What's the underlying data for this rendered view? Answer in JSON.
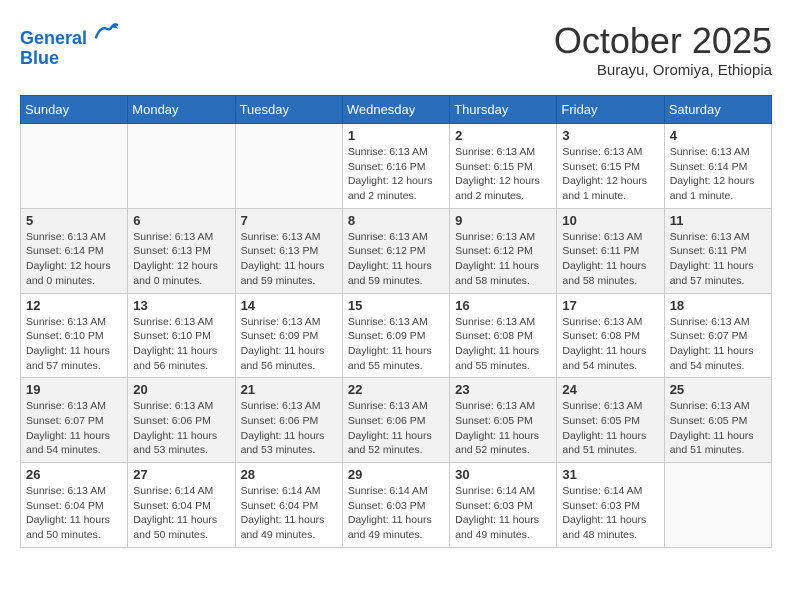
{
  "logo": {
    "line1": "General",
    "line2": "Blue"
  },
  "title": "October 2025",
  "subtitle": "Burayu, Oromiya, Ethiopia",
  "headers": [
    "Sunday",
    "Monday",
    "Tuesday",
    "Wednesday",
    "Thursday",
    "Friday",
    "Saturday"
  ],
  "weeks": [
    [
      {
        "day": "",
        "info": ""
      },
      {
        "day": "",
        "info": ""
      },
      {
        "day": "",
        "info": ""
      },
      {
        "day": "1",
        "info": "Sunrise: 6:13 AM\nSunset: 6:16 PM\nDaylight: 12 hours\nand 2 minutes."
      },
      {
        "day": "2",
        "info": "Sunrise: 6:13 AM\nSunset: 6:15 PM\nDaylight: 12 hours\nand 2 minutes."
      },
      {
        "day": "3",
        "info": "Sunrise: 6:13 AM\nSunset: 6:15 PM\nDaylight: 12 hours\nand 1 minute."
      },
      {
        "day": "4",
        "info": "Sunrise: 6:13 AM\nSunset: 6:14 PM\nDaylight: 12 hours\nand 1 minute."
      }
    ],
    [
      {
        "day": "5",
        "info": "Sunrise: 6:13 AM\nSunset: 6:14 PM\nDaylight: 12 hours\nand 0 minutes."
      },
      {
        "day": "6",
        "info": "Sunrise: 6:13 AM\nSunset: 6:13 PM\nDaylight: 12 hours\nand 0 minutes."
      },
      {
        "day": "7",
        "info": "Sunrise: 6:13 AM\nSunset: 6:13 PM\nDaylight: 11 hours\nand 59 minutes."
      },
      {
        "day": "8",
        "info": "Sunrise: 6:13 AM\nSunset: 6:12 PM\nDaylight: 11 hours\nand 59 minutes."
      },
      {
        "day": "9",
        "info": "Sunrise: 6:13 AM\nSunset: 6:12 PM\nDaylight: 11 hours\nand 58 minutes."
      },
      {
        "day": "10",
        "info": "Sunrise: 6:13 AM\nSunset: 6:11 PM\nDaylight: 11 hours\nand 58 minutes."
      },
      {
        "day": "11",
        "info": "Sunrise: 6:13 AM\nSunset: 6:11 PM\nDaylight: 11 hours\nand 57 minutes."
      }
    ],
    [
      {
        "day": "12",
        "info": "Sunrise: 6:13 AM\nSunset: 6:10 PM\nDaylight: 11 hours\nand 57 minutes."
      },
      {
        "day": "13",
        "info": "Sunrise: 6:13 AM\nSunset: 6:10 PM\nDaylight: 11 hours\nand 56 minutes."
      },
      {
        "day": "14",
        "info": "Sunrise: 6:13 AM\nSunset: 6:09 PM\nDaylight: 11 hours\nand 56 minutes."
      },
      {
        "day": "15",
        "info": "Sunrise: 6:13 AM\nSunset: 6:09 PM\nDaylight: 11 hours\nand 55 minutes."
      },
      {
        "day": "16",
        "info": "Sunrise: 6:13 AM\nSunset: 6:08 PM\nDaylight: 11 hours\nand 55 minutes."
      },
      {
        "day": "17",
        "info": "Sunrise: 6:13 AM\nSunset: 6:08 PM\nDaylight: 11 hours\nand 54 minutes."
      },
      {
        "day": "18",
        "info": "Sunrise: 6:13 AM\nSunset: 6:07 PM\nDaylight: 11 hours\nand 54 minutes."
      }
    ],
    [
      {
        "day": "19",
        "info": "Sunrise: 6:13 AM\nSunset: 6:07 PM\nDaylight: 11 hours\nand 54 minutes."
      },
      {
        "day": "20",
        "info": "Sunrise: 6:13 AM\nSunset: 6:06 PM\nDaylight: 11 hours\nand 53 minutes."
      },
      {
        "day": "21",
        "info": "Sunrise: 6:13 AM\nSunset: 6:06 PM\nDaylight: 11 hours\nand 53 minutes."
      },
      {
        "day": "22",
        "info": "Sunrise: 6:13 AM\nSunset: 6:06 PM\nDaylight: 11 hours\nand 52 minutes."
      },
      {
        "day": "23",
        "info": "Sunrise: 6:13 AM\nSunset: 6:05 PM\nDaylight: 11 hours\nand 52 minutes."
      },
      {
        "day": "24",
        "info": "Sunrise: 6:13 AM\nSunset: 6:05 PM\nDaylight: 11 hours\nand 51 minutes."
      },
      {
        "day": "25",
        "info": "Sunrise: 6:13 AM\nSunset: 6:05 PM\nDaylight: 11 hours\nand 51 minutes."
      }
    ],
    [
      {
        "day": "26",
        "info": "Sunrise: 6:13 AM\nSunset: 6:04 PM\nDaylight: 11 hours\nand 50 minutes."
      },
      {
        "day": "27",
        "info": "Sunrise: 6:14 AM\nSunset: 6:04 PM\nDaylight: 11 hours\nand 50 minutes."
      },
      {
        "day": "28",
        "info": "Sunrise: 6:14 AM\nSunset: 6:04 PM\nDaylight: 11 hours\nand 49 minutes."
      },
      {
        "day": "29",
        "info": "Sunrise: 6:14 AM\nSunset: 6:03 PM\nDaylight: 11 hours\nand 49 minutes."
      },
      {
        "day": "30",
        "info": "Sunrise: 6:14 AM\nSunset: 6:03 PM\nDaylight: 11 hours\nand 49 minutes."
      },
      {
        "day": "31",
        "info": "Sunrise: 6:14 AM\nSunset: 6:03 PM\nDaylight: 11 hours\nand 48 minutes."
      },
      {
        "day": "",
        "info": ""
      }
    ]
  ]
}
